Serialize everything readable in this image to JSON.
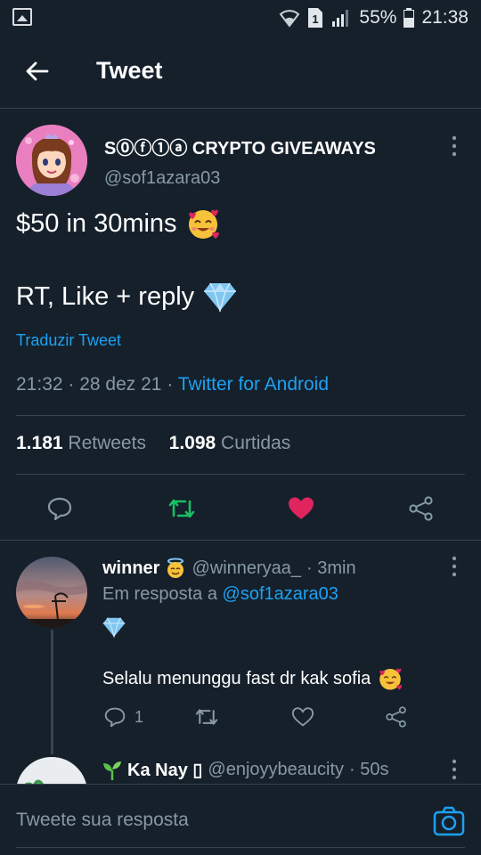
{
  "status_bar": {
    "battery": "55%",
    "time": "21:38",
    "sim_slot": "1"
  },
  "header": {
    "title": "Tweet",
    "back_icon": "arrow-left-icon"
  },
  "tweet": {
    "author_name": "S⓪ⓕ①ⓐ CRYPTO GIVEAWAYS",
    "author_handle": "@sof1azara03",
    "text_line1": "$50 in 30mins",
    "text_line2": "RT, Like + reply",
    "translate": "Traduzir Tweet",
    "time": "21:32",
    "date": "28 dez 21",
    "source": "Twitter for Android",
    "retweets_count": "1.181",
    "retweets_label": "Retweets",
    "likes_count": "1.098",
    "likes_label": "Curtidas",
    "liked": true,
    "colors": {
      "link": "#1da1f2",
      "retweet": "#17bf63",
      "like": "#e0245e"
    }
  },
  "replies": [
    {
      "name": "winner",
      "handle": "@winneryaa_",
      "age": "· 3min",
      "replying_to_label": "Em resposta a",
      "replying_to": "@sof1azara03",
      "body": "Selalu menunggu fast dr kak sofia",
      "reply_count": "1"
    },
    {
      "name": "Ka Nay",
      "name_suffix": "▯",
      "handle": "@enjoyybeaucity",
      "age": "· 50s"
    }
  ],
  "compose": {
    "placeholder": "Tweete sua resposta"
  }
}
